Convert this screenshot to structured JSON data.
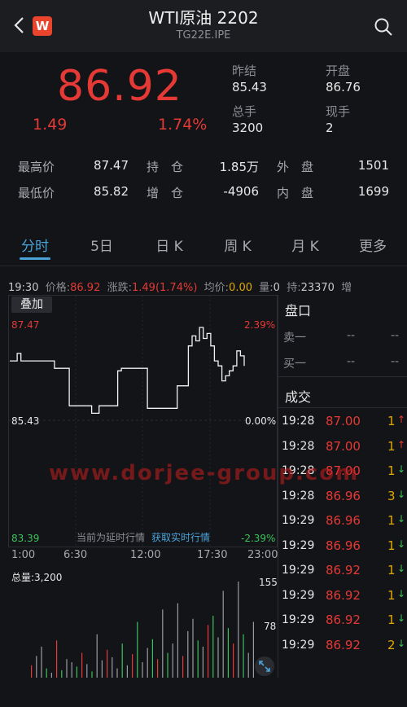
{
  "header": {
    "title": "WTI原油 2202",
    "subtitle": "TG22E.IPE",
    "logo_text": "W"
  },
  "quote": {
    "price": "86.92",
    "change": "1.49",
    "change_pct": "1.74%",
    "fields": [
      {
        "label": "昨结",
        "value": "85.43"
      },
      {
        "label": "开盘",
        "value": "86.76"
      },
      {
        "label": "总手",
        "value": "3200"
      },
      {
        "label": "现手",
        "value": "2"
      }
    ]
  },
  "stats": {
    "high_label": "最高价",
    "high": "87.47",
    "low_label": "最低价",
    "low": "85.82",
    "oi_label": "持　仓",
    "oi": "1.85万",
    "oi_chg_label": "增　仓",
    "oi_chg": "-4906",
    "outer_label": "外　盘",
    "outer": "1501",
    "inner_label": "内　盘",
    "inner": "1699"
  },
  "tabs": [
    {
      "label": "分时",
      "active": true
    },
    {
      "label": "5日"
    },
    {
      "label": "日 K"
    },
    {
      "label": "周 K"
    },
    {
      "label": "月 K"
    },
    {
      "label": "更多"
    }
  ],
  "info": {
    "time": "19:30",
    "price_label": "价格:",
    "price": "86.92",
    "chg_label": "涨跌:",
    "chg": "1.49(1.74%)",
    "avg_label": "均价:",
    "avg": "0.00",
    "vol_label": "量:",
    "vol": "0",
    "oi_label": "持:",
    "oi": "23370",
    "more": "增"
  },
  "chart": {
    "overlay_label": "叠加",
    "y_high": "87.47",
    "y_high_pct": "2.39%",
    "y_mid": "85.43",
    "y_mid_pct": "0.00%",
    "y_low": "83.39",
    "y_low_pct": "-2.39%",
    "delay_note": "当前为延时行情",
    "realtime_link": "获取实时行情",
    "time_labels": [
      "1:00",
      "6:30",
      "12:00",
      "17:30",
      "23:00"
    ],
    "volume_title": "总量:3,200",
    "vol_max": "155",
    "vol_mid": "78"
  },
  "chart_data": {
    "type": "line",
    "ylim": [
      83.39,
      87.47
    ],
    "y_base": 85.43,
    "series": [
      {
        "values": [
          86.8,
          86.8,
          86.95,
          86.8,
          86.8,
          86.8,
          86.8,
          86.8,
          86.8,
          86.8,
          86.8,
          86.8,
          86.65,
          86.65,
          86.65,
          86.65,
          85.9,
          85.9,
          85.9,
          85.9,
          85.9,
          85.9,
          85.75,
          85.75,
          85.9,
          85.9,
          85.9,
          85.9,
          85.9,
          86.6,
          86.65,
          86.65,
          86.65,
          86.65,
          86.65,
          86.65,
          86.65,
          85.85,
          85.85,
          85.85,
          85.85,
          85.85,
          85.85,
          85.85,
          85.85,
          86.3,
          86.3,
          86.3,
          87.1,
          87.3,
          87.2,
          87.47,
          87.25,
          87.35,
          87.1,
          86.8,
          86.7,
          86.4,
          86.5,
          86.6,
          86.7,
          87.0,
          86.9,
          86.7
        ]
      }
    ],
    "volume_ylim": [
      0,
      155
    ]
  },
  "right_panel": {
    "orderbook_title": "盘口",
    "ask_label": "卖一",
    "ask_price": "--",
    "ask_vol": "--",
    "bid_label": "买一",
    "bid_price": "--",
    "bid_vol": "--",
    "trades_title": "成交",
    "trades": [
      {
        "time": "19:28",
        "price": "87.00",
        "vol": "1",
        "dir": "↑",
        "color": "#e53935"
      },
      {
        "time": "19:28",
        "price": "87.00",
        "vol": "1",
        "dir": "↑",
        "color": "#e53935"
      },
      {
        "time": "19:28",
        "price": "87.00",
        "vol": "1",
        "dir": "↓",
        "color": "#3cc25a"
      },
      {
        "time": "19:28",
        "price": "86.96",
        "vol": "3",
        "dir": "↓",
        "color": "#3cc25a"
      },
      {
        "time": "19:29",
        "price": "86.96",
        "vol": "1",
        "dir": "↓",
        "color": "#3cc25a"
      },
      {
        "time": "19:29",
        "price": "86.96",
        "vol": "1",
        "dir": "↓",
        "color": "#3cc25a"
      },
      {
        "time": "19:29",
        "price": "86.92",
        "vol": "1",
        "dir": "↓",
        "color": "#3cc25a"
      },
      {
        "time": "19:29",
        "price": "86.92",
        "vol": "1",
        "dir": "↓",
        "color": "#3cc25a"
      },
      {
        "time": "19:29",
        "price": "86.92",
        "vol": "1",
        "dir": "↓",
        "color": "#3cc25a"
      },
      {
        "time": "19:29",
        "price": "86.92",
        "vol": "2",
        "dir": "↓",
        "color": "#3cc25a"
      }
    ]
  },
  "watermark": "www.dorjee-group.com",
  "colors": {
    "up": "#e53935",
    "down": "#3cc25a",
    "accent": "#4aa3d8",
    "background": "#131418"
  }
}
